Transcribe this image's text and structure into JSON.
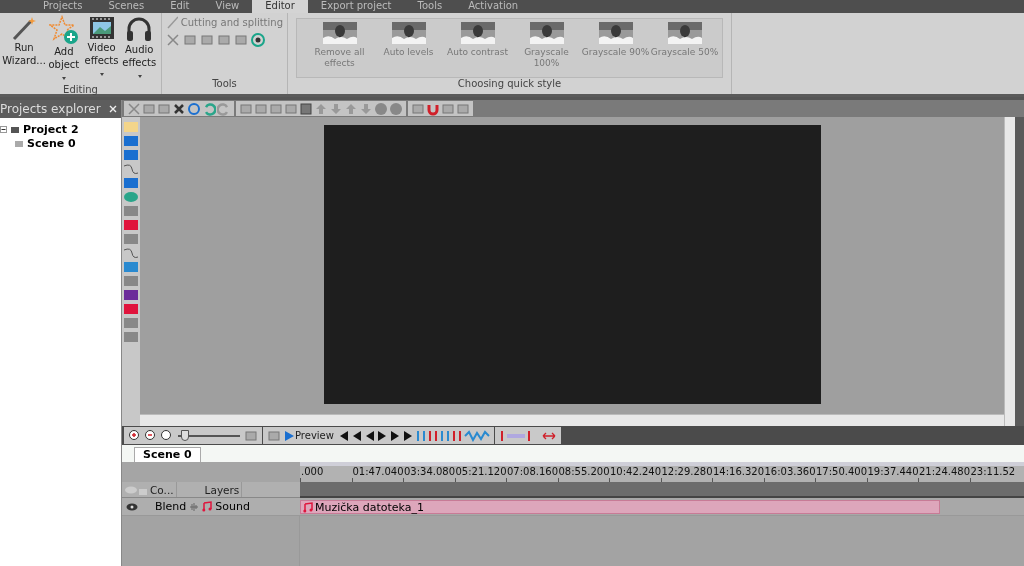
{
  "menu_tabs": [
    {
      "label": "Projects",
      "selected": false
    },
    {
      "label": "Scenes",
      "selected": false
    },
    {
      "label": "Edit",
      "selected": false
    },
    {
      "label": "View",
      "selected": false
    },
    {
      "label": "Editor",
      "selected": true
    },
    {
      "label": "Export project",
      "selected": false
    },
    {
      "label": "Tools",
      "selected": false
    },
    {
      "label": "Activation",
      "selected": false
    }
  ],
  "ribbon": {
    "editing": {
      "title": "Editing",
      "buttons": [
        {
          "kind": "wizard",
          "label": "Run Wizard...",
          "dropdown": false
        },
        {
          "kind": "add",
          "label": "Add object",
          "dropdown": true
        },
        {
          "kind": "video",
          "label": "Video effects",
          "dropdown": true
        },
        {
          "kind": "audio",
          "label": "Audio effects",
          "dropdown": true
        }
      ]
    },
    "tools": {
      "title": "Tools",
      "cutting": {
        "label": "Cutting and splitting",
        "disabled": true
      }
    },
    "quick_style": {
      "title": "Choosing quick style",
      "items": [
        {
          "label": "Remove all effects",
          "disabled": true
        },
        {
          "label": "Auto levels",
          "disabled": true
        },
        {
          "label": "Auto contrast",
          "disabled": true
        },
        {
          "label": "Grayscale 100%",
          "disabled": true
        },
        {
          "label": "Grayscale 90%",
          "disabled": true
        },
        {
          "label": "Grayscale 50%",
          "disabled": true
        }
      ]
    }
  },
  "projects_explorer": {
    "title": "Projects explorer",
    "tree": [
      {
        "label": "Project 2",
        "expanded": true,
        "children": [
          {
            "label": "Scene 0"
          }
        ]
      }
    ]
  },
  "timeline_toolbar": {
    "zoom": {
      "level": 0.05
    },
    "preview": "Preview"
  },
  "scene_tabs": [
    {
      "label": "Scene 0",
      "selected": true
    }
  ],
  "timeline": {
    "ruler": [
      ".000",
      "01:47.040",
      "03:34.080",
      "05:21.120",
      "07:08.160",
      "08:55.200",
      "10:42.240",
      "12:29.280",
      "14:16.320",
      "16:03.360",
      "17:50.400",
      "19:37.440",
      "21:24.480",
      "23:11.52"
    ],
    "columns": [
      "Co...",
      "Layers"
    ],
    "tracks": [
      {
        "visible": true,
        "blend": "Blend",
        "name": "Sound",
        "clip": "Muzička datoteka_1"
      }
    ]
  }
}
